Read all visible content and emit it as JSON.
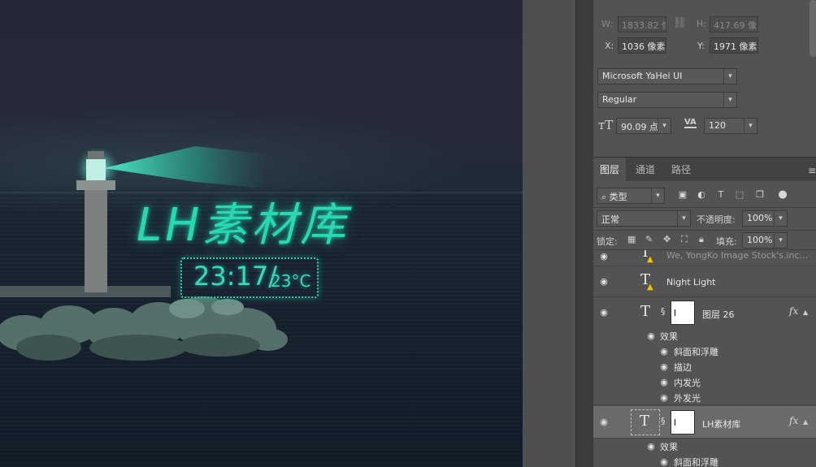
{
  "canvas": {
    "neon_title": "LH素材库",
    "clock_time": "23:17/",
    "clock_temp": "23°C",
    "colors": {
      "neon": "#27d8b0",
      "sky": "#252839",
      "sea": "#121c27"
    }
  },
  "properties": {
    "w_label": "W:",
    "w_value": "1833.82 像",
    "link_icon": "link-icon",
    "h_label": "H:",
    "h_value": "417.69 像",
    "x_label": "X:",
    "x_value": "1036 像素",
    "y_label": "Y:",
    "y_value": "1971 像素",
    "font_family": "Microsoft YaHei UI",
    "font_style": "Regular",
    "font_size": "90.09 点",
    "tracking": "120"
  },
  "layers_panel": {
    "tabs": [
      "图层",
      "通道",
      "路径"
    ],
    "active_tab": "图层",
    "filter_kind": "类型",
    "blend_mode": "正常",
    "opacity_label": "不透明度:",
    "opacity_value": "100%",
    "lock_label": "锁定:",
    "fill_label": "填充:",
    "fill_value": "100%",
    "layers": [
      {
        "name": "We, YongKo Image Stock's.inc...",
        "type": "text",
        "warning": true
      },
      {
        "name": "Night Light",
        "type": "text",
        "warning": true
      },
      {
        "name": "图层 26",
        "type": "text",
        "has_mask": true,
        "fx": "fx",
        "effects_label": "效果",
        "effects": [
          "斜面和浮雕",
          "描边",
          "内发光",
          "外发光"
        ]
      },
      {
        "name": "LH素材库",
        "type": "text",
        "has_mask": true,
        "fx": "fx",
        "selected": true,
        "effects_label": "效果",
        "effects": [
          "斜面和浮雕"
        ]
      }
    ]
  }
}
